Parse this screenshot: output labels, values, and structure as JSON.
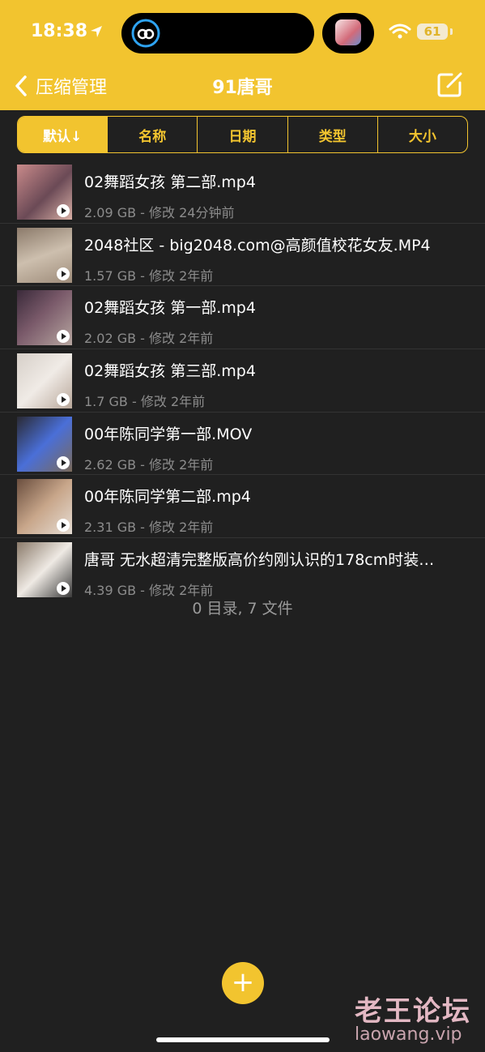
{
  "status": {
    "time": "18:38",
    "battery": "61"
  },
  "nav": {
    "back_label": "压缩管理",
    "title": "91唐哥"
  },
  "sort_tabs": [
    "默认↓",
    "名称",
    "日期",
    "类型",
    "大小"
  ],
  "files": [
    {
      "name": "02舞蹈女孩 第二部.mp4",
      "meta": "2.09 GB - 修改 24分钟前"
    },
    {
      "name": "2048社区 - big2048.com@高颜值校花女友.MP4",
      "meta": "1.57 GB - 修改 2年前"
    },
    {
      "name": "02舞蹈女孩 第一部.mp4",
      "meta": "2.02 GB - 修改 2年前"
    },
    {
      "name": "02舞蹈女孩 第三部.mp4",
      "meta": "1.7 GB - 修改 2年前"
    },
    {
      "name": "00年陈同学第一部.MOV",
      "meta": "2.62 GB - 修改 2年前"
    },
    {
      "name": "00年陈同学第二部.mp4",
      "meta": "2.31 GB - 修改 2年前"
    },
    {
      "name": "唐哥 无水超清完整版高价约刚认识的178cm时装…",
      "meta": "4.39 GB - 修改 2年前"
    }
  ],
  "summary": "0 目录, 7 文件",
  "fab_label": "+",
  "watermark": {
    "cn": "老王论坛",
    "en": "laowang.vip"
  },
  "colors": {
    "accent": "#f2c42f",
    "background": "#202020"
  }
}
